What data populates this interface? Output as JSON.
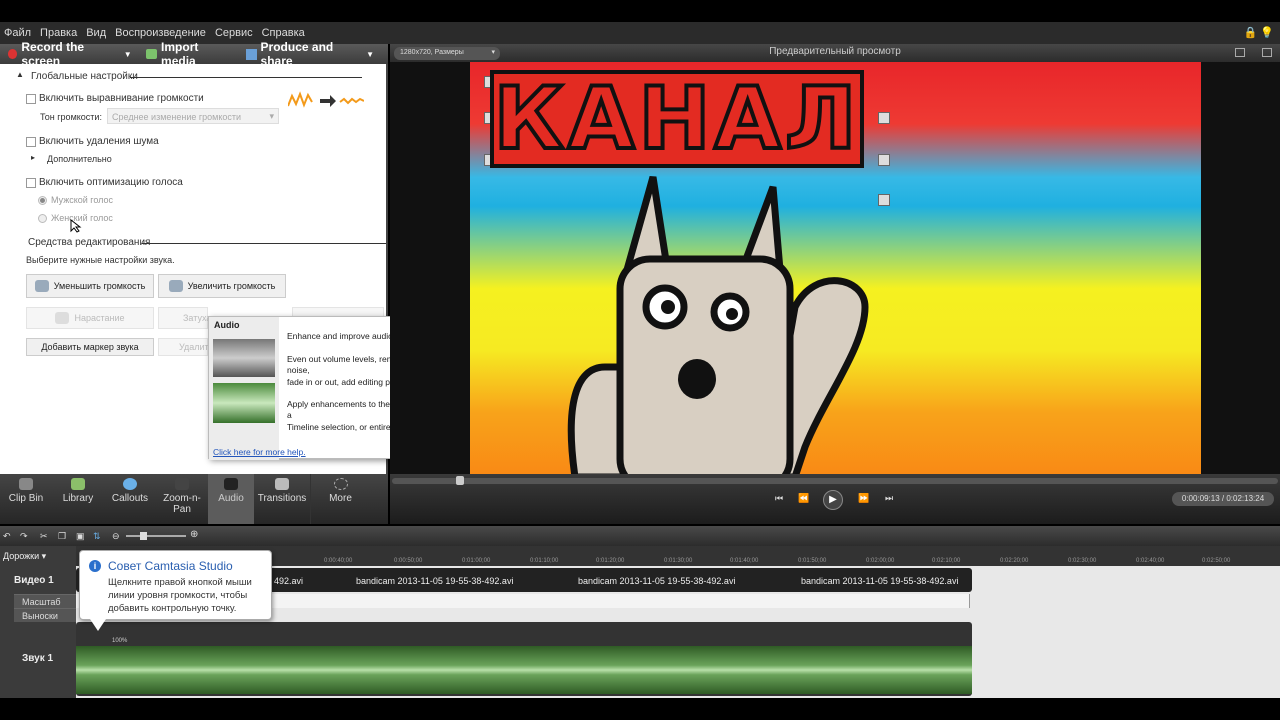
{
  "menu": [
    "Файл",
    "Правка",
    "Вид",
    "Воспроизведение",
    "Сервис",
    "Справка"
  ],
  "toolbar": {
    "record": "Record the screen",
    "import": "Import media",
    "produce": "Produce and share"
  },
  "audio_panel": {
    "global_settings": "Глобальные настройки",
    "volume_leveling": "Включить выравнивание громкости",
    "volume_tone_label": "Тон громкости:",
    "volume_tone_value": "Среднее изменение громкости",
    "noise_removal": "Включить удаления шума",
    "advanced": "Дополнительно",
    "voice_opt": "Включить оптимизацию голоса",
    "male_voice": "Мужской голос",
    "female_voice": "Женский голос",
    "editing_tools": "Средства редактирования",
    "choose_settings": "Выберите нужные настройки звука.",
    "decrease_volume": "Уменьшить громкость",
    "increase_volume": "Увеличить громкость",
    "fade_in": "Нарастание",
    "fade_out": "Затуха",
    "add_marker": "Добавить маркер звука",
    "delete": "Удалить"
  },
  "tooltip": {
    "title": "Audio",
    "line1": "Enhance and improve audio quality.",
    "line2": "Even out volume levels, remove background noise,",
    "line3": "fade in or out, add editing points, and more.",
    "line4": "Apply enhancements to the duration of a clip, a",
    "line5": "Timeline selection, or entire Timeline.",
    "link": "Click here for more help."
  },
  "preview": {
    "size": "1280x720, Размеры",
    "title": "Предварительный просмотр",
    "overlay_text": "КАНАЛ",
    "timecode": "0:00:09:13 / 0:02:13:24"
  },
  "tabs": [
    "Clip Bin",
    "Library",
    "Callouts",
    "Zoom-n-Pan",
    "Audio",
    "Transitions",
    "More"
  ],
  "timeline": {
    "tracks_label": "Дорожки",
    "video_track": "Видео 1",
    "zoom_track": "Масштаб",
    "callouts_track": "Выноски",
    "audio_track": "Звук 1",
    "clip_names": [
      "492.avi",
      "bandicam 2013-11-05 19-55-38-492.avi",
      "bandicam 2013-11-05 19-55-38-492.avi",
      "bandicam 2013-11-05 19-55-38-492.avi"
    ],
    "audio_level": "100%",
    "ruler": [
      "0:00:40;00",
      "0:00:50;00",
      "0:01:00;00",
      "0:01:10;00",
      "0:01:20;00",
      "0:01:30;00",
      "0:01:40;00",
      "0:01:50;00",
      "0:02:00;00",
      "0:02:10;00",
      "0:02:20;00",
      "0:02:30;00",
      "0:02:40;00",
      "0:02:50;00"
    ]
  },
  "tip": {
    "title": "Совет Camtasia Studio",
    "body": "Щелкните правой кнопкой мыши линии уровня громкости, чтобы добавить контрольную точку."
  }
}
